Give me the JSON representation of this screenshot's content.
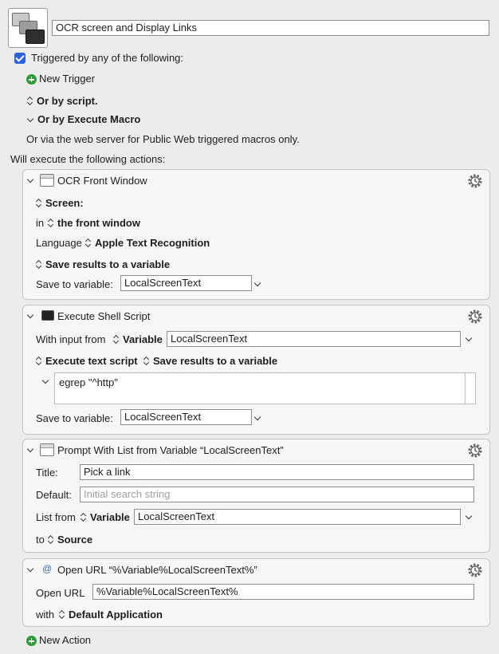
{
  "macro": {
    "name": "OCR screen and Display Links",
    "triggered_label": "Triggered by any of the following:",
    "new_trigger": "New Trigger",
    "or_by_script": "Or by script.",
    "or_by_execute_macro": "Or by Execute Macro",
    "web_server_note": "Or via the web server for Public Web triggered macros only.",
    "will_execute": "Will execute the following actions:"
  },
  "actions": {
    "ocr": {
      "title": "OCR Front Window",
      "screen": "Screen:",
      "in": "in",
      "window": "the front window",
      "language_label": "Language",
      "language_value": "Apple Text Recognition",
      "save_results": "Save results to a variable",
      "save_to_label": "Save to variable:",
      "save_to_value": "LocalScreenText"
    },
    "shell": {
      "title": "Execute Shell Script",
      "input_label": "With input from",
      "input_source": "Variable",
      "input_value": "LocalScreenText",
      "execute_text": "Execute text script",
      "save_results": "Save results to a variable",
      "script": "egrep \"^http\"",
      "save_to_label": "Save to variable:",
      "save_to_value": "LocalScreenText"
    },
    "prompt": {
      "title": "Prompt With List from Variable “LocalScreenText”",
      "title_label": "Title:",
      "title_value": "Pick a link",
      "default_label": "Default:",
      "default_placeholder": "Initial search string",
      "list_from_label": "List from",
      "list_from_source": "Variable",
      "list_from_value": "LocalScreenText",
      "to_label": "to",
      "to_value": "Source"
    },
    "open_url": {
      "title": "Open URL “%Variable%LocalScreenText%”",
      "label": "Open URL",
      "value": "%Variable%LocalScreenText%",
      "with_label": "with",
      "with_value": "Default Application"
    }
  },
  "new_action": "New Action"
}
